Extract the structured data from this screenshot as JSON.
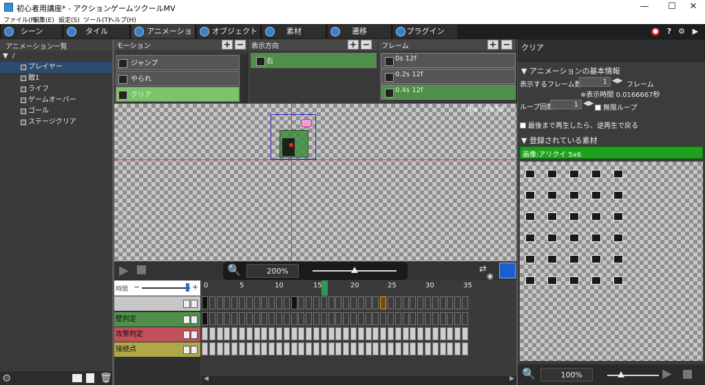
{
  "window": {
    "title": "初心者用講座* - アクションゲームツクールMV",
    "minimize": "—",
    "maximize": "☐",
    "close": "✕"
  },
  "menu": [
    "ファイル(F)",
    "編集(E)",
    "設定(S)",
    "ツール(T)",
    "ヘルプ(H)"
  ],
  "tabs": [
    {
      "label": "シーン"
    },
    {
      "label": "タイル"
    },
    {
      "label": "アニメーション"
    },
    {
      "label": "オブジェクト"
    },
    {
      "label": "素材"
    },
    {
      "label": "遷移"
    },
    {
      "label": "プラグイン"
    }
  ],
  "left_panel": {
    "title": "アニメーション一覧",
    "root": "/",
    "items": [
      "プレイヤー",
      "敵1",
      "ライフ",
      "ゲームオーバー",
      "ゴール",
      "ステージクリア"
    ],
    "selected_index": 0
  },
  "motion_panel": {
    "title": "モーション",
    "items": [
      "ジャンプ",
      "やられ",
      "クリア"
    ],
    "selected_index": 2
  },
  "direction_panel": {
    "title": "表示方向",
    "items": [
      "右"
    ]
  },
  "frame_panel": {
    "title": "フレーム",
    "items": [
      "0s 12f",
      "0.2s 12f",
      "0.4s 12f"
    ],
    "selected_index": 2
  },
  "canvas": {
    "fps": "fps : 59.50"
  },
  "preview": {
    "zoom": "200%",
    "zoom_level": 0.5
  },
  "timeline": {
    "time_label": "時間",
    "ticks": [
      "0",
      "5",
      "10",
      "15",
      "20",
      "25",
      "30",
      "35"
    ],
    "tracks": [
      {
        "label": "",
        "color": "#c8c8c8"
      },
      {
        "label": "壁判定",
        "color": "#4e8f4a"
      },
      {
        "label": "攻撃判定",
        "color": "#c0505a"
      },
      {
        "label": "接続点",
        "color": "#b0a848"
      }
    ]
  },
  "right_panel": {
    "title": "クリア",
    "section_info": "アニメーションの基本情報",
    "frames_label": "表示するフレーム数：",
    "frames_value": "1",
    "frames_unit": "フレーム",
    "display_time": "※表示時間 0.0166667秒",
    "loop_label": "ループ回数",
    "loop_value": "1",
    "infinite_loop": "無限ループ",
    "reverse_label": "最後まで再生したら、逆再生で戻る",
    "section_material": "登録されている素材",
    "material": "画像:アリクイ 5x6",
    "zoom": "100%"
  },
  "colors": {
    "accent_blue": "#2b4b6f",
    "active_green": "#7bc46a",
    "material_green": "#1ea21e"
  }
}
